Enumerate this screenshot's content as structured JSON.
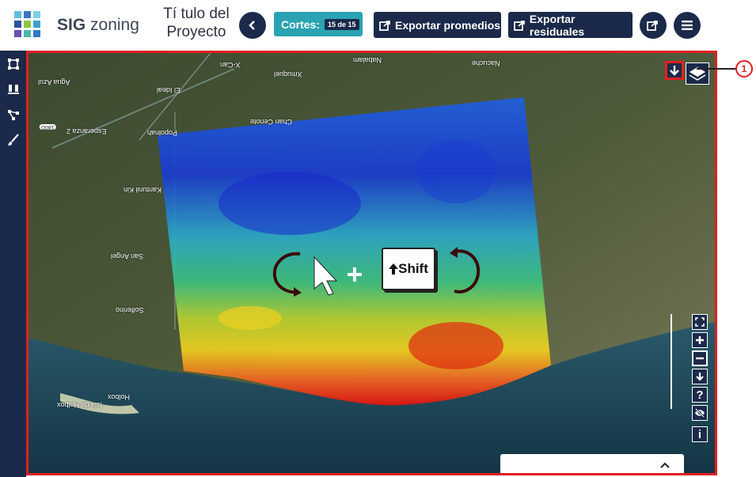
{
  "header": {
    "logo_brand_bold": "SIG",
    "logo_brand_rest": "zoning",
    "project_title": "Tí tulo del Proyecto",
    "cortes_label": "Cortes:",
    "cortes_badge": "15 de 15",
    "export_averages_label": "Exportar promedios",
    "export_residuals_label": "Exportar residuales"
  },
  "map": {
    "places": [
      "Agua Azul",
      "El Ideal",
      "X-Can",
      "Xmuquel",
      "Nabalam",
      "Nacuche",
      "Esperanza 2",
      "Popolnah",
      "Chan Cenote",
      "Kantunil Kin",
      "San Angel",
      "Solferino",
      "Isla de Holbox",
      "Holbox"
    ],
    "road_badge": "180D",
    "shift_key_label": "Shift",
    "info_label": "i",
    "help_label": "?"
  },
  "annotations": {
    "callout_number": "1"
  },
  "colors": {
    "navy": "#1b2a4a",
    "teal": "#2aa3b2",
    "highlight_red": "#e02020"
  }
}
